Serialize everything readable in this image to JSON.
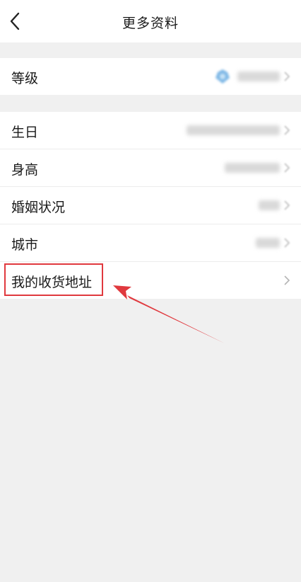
{
  "header": {
    "title": "更多资料",
    "back_icon": "chevron-left-icon"
  },
  "level_section": {
    "label": "等级",
    "value_blurred": true
  },
  "info_section": {
    "items": [
      {
        "label": "生日",
        "value_blurred": true
      },
      {
        "label": "身高",
        "value_blurred": true
      },
      {
        "label": "婚姻状况",
        "value_blurred": true
      },
      {
        "label": "城市",
        "value_blurred": true
      },
      {
        "label": "我的收货地址",
        "value_blurred": false
      }
    ]
  },
  "annotation": {
    "color": "#e0393e"
  },
  "colors": {
    "background": "#f0f0f0",
    "card": "#ffffff",
    "divider": "#ececec"
  }
}
